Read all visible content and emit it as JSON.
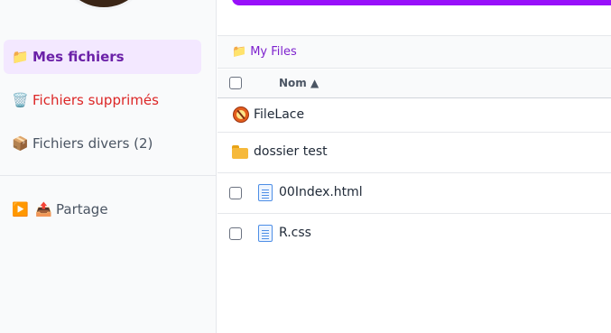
{
  "sidebar": {
    "items": [
      {
        "icon": "folder-icon",
        "glyph": "📁",
        "label": "Mes fichiers"
      },
      {
        "icon": "trash-icon",
        "glyph": "🗑️",
        "label": "Fichiers supprimés"
      },
      {
        "icon": "package-icon",
        "glyph": "📦",
        "label": "Fichiers divers (2)"
      },
      {
        "icon": "share-icon",
        "glyph": "📤",
        "label": "Partage"
      }
    ],
    "share_toggle_glyph": "▶️"
  },
  "breadcrumb": {
    "icon": "folder-icon",
    "glyph": "📁",
    "label": "My Files"
  },
  "table": {
    "column_name": "Nom ▲",
    "rows": [
      {
        "name": "FileLace",
        "icon": "app-icon",
        "selectable": false
      },
      {
        "name": "dossier test",
        "icon": "folder-icon",
        "selectable": false
      },
      {
        "name": "00Index.html",
        "icon": "document-icon",
        "selectable": true
      },
      {
        "name": "R.css",
        "icon": "document-icon",
        "selectable": true
      }
    ]
  },
  "colors": {
    "accent": "#9810fa",
    "active_bg": "#f3e8ff",
    "active_text": "#6b21a8",
    "danger_text": "#dc2626",
    "breadcrumb_text": "#7e22ce"
  }
}
